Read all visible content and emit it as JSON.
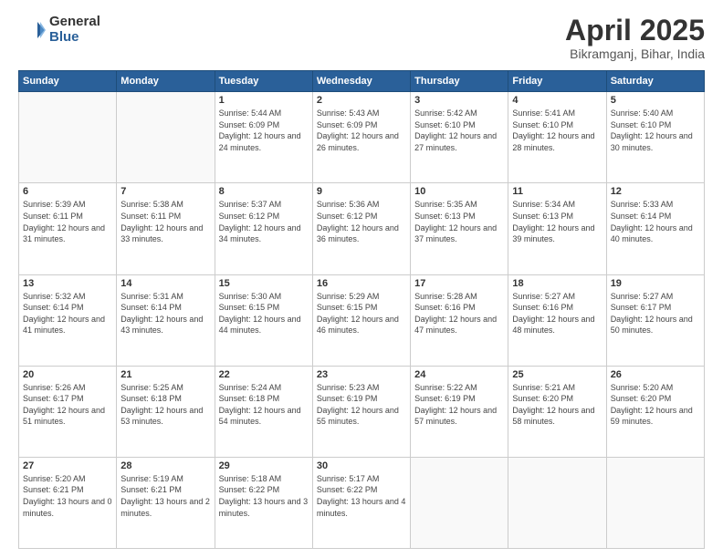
{
  "logo": {
    "general": "General",
    "blue": "Blue"
  },
  "header": {
    "title": "April 2025",
    "subtitle": "Bikramganj, Bihar, India"
  },
  "weekdays": [
    "Sunday",
    "Monday",
    "Tuesday",
    "Wednesday",
    "Thursday",
    "Friday",
    "Saturday"
  ],
  "weeks": [
    [
      null,
      null,
      {
        "day": "1",
        "sunrise": "5:44 AM",
        "sunset": "6:09 PM",
        "daylight": "12 hours and 24 minutes."
      },
      {
        "day": "2",
        "sunrise": "5:43 AM",
        "sunset": "6:09 PM",
        "daylight": "12 hours and 26 minutes."
      },
      {
        "day": "3",
        "sunrise": "5:42 AM",
        "sunset": "6:10 PM",
        "daylight": "12 hours and 27 minutes."
      },
      {
        "day": "4",
        "sunrise": "5:41 AM",
        "sunset": "6:10 PM",
        "daylight": "12 hours and 28 minutes."
      },
      {
        "day": "5",
        "sunrise": "5:40 AM",
        "sunset": "6:10 PM",
        "daylight": "12 hours and 30 minutes."
      }
    ],
    [
      {
        "day": "6",
        "sunrise": "5:39 AM",
        "sunset": "6:11 PM",
        "daylight": "12 hours and 31 minutes."
      },
      {
        "day": "7",
        "sunrise": "5:38 AM",
        "sunset": "6:11 PM",
        "daylight": "12 hours and 33 minutes."
      },
      {
        "day": "8",
        "sunrise": "5:37 AM",
        "sunset": "6:12 PM",
        "daylight": "12 hours and 34 minutes."
      },
      {
        "day": "9",
        "sunrise": "5:36 AM",
        "sunset": "6:12 PM",
        "daylight": "12 hours and 36 minutes."
      },
      {
        "day": "10",
        "sunrise": "5:35 AM",
        "sunset": "6:13 PM",
        "daylight": "12 hours and 37 minutes."
      },
      {
        "day": "11",
        "sunrise": "5:34 AM",
        "sunset": "6:13 PM",
        "daylight": "12 hours and 39 minutes."
      },
      {
        "day": "12",
        "sunrise": "5:33 AM",
        "sunset": "6:14 PM",
        "daylight": "12 hours and 40 minutes."
      }
    ],
    [
      {
        "day": "13",
        "sunrise": "5:32 AM",
        "sunset": "6:14 PM",
        "daylight": "12 hours and 41 minutes."
      },
      {
        "day": "14",
        "sunrise": "5:31 AM",
        "sunset": "6:14 PM",
        "daylight": "12 hours and 43 minutes."
      },
      {
        "day": "15",
        "sunrise": "5:30 AM",
        "sunset": "6:15 PM",
        "daylight": "12 hours and 44 minutes."
      },
      {
        "day": "16",
        "sunrise": "5:29 AM",
        "sunset": "6:15 PM",
        "daylight": "12 hours and 46 minutes."
      },
      {
        "day": "17",
        "sunrise": "5:28 AM",
        "sunset": "6:16 PM",
        "daylight": "12 hours and 47 minutes."
      },
      {
        "day": "18",
        "sunrise": "5:27 AM",
        "sunset": "6:16 PM",
        "daylight": "12 hours and 48 minutes."
      },
      {
        "day": "19",
        "sunrise": "5:27 AM",
        "sunset": "6:17 PM",
        "daylight": "12 hours and 50 minutes."
      }
    ],
    [
      {
        "day": "20",
        "sunrise": "5:26 AM",
        "sunset": "6:17 PM",
        "daylight": "12 hours and 51 minutes."
      },
      {
        "day": "21",
        "sunrise": "5:25 AM",
        "sunset": "6:18 PM",
        "daylight": "12 hours and 53 minutes."
      },
      {
        "day": "22",
        "sunrise": "5:24 AM",
        "sunset": "6:18 PM",
        "daylight": "12 hours and 54 minutes."
      },
      {
        "day": "23",
        "sunrise": "5:23 AM",
        "sunset": "6:19 PM",
        "daylight": "12 hours and 55 minutes."
      },
      {
        "day": "24",
        "sunrise": "5:22 AM",
        "sunset": "6:19 PM",
        "daylight": "12 hours and 57 minutes."
      },
      {
        "day": "25",
        "sunrise": "5:21 AM",
        "sunset": "6:20 PM",
        "daylight": "12 hours and 58 minutes."
      },
      {
        "day": "26",
        "sunrise": "5:20 AM",
        "sunset": "6:20 PM",
        "daylight": "12 hours and 59 minutes."
      }
    ],
    [
      {
        "day": "27",
        "sunrise": "5:20 AM",
        "sunset": "6:21 PM",
        "daylight": "13 hours and 0 minutes."
      },
      {
        "day": "28",
        "sunrise": "5:19 AM",
        "sunset": "6:21 PM",
        "daylight": "13 hours and 2 minutes."
      },
      {
        "day": "29",
        "sunrise": "5:18 AM",
        "sunset": "6:22 PM",
        "daylight": "13 hours and 3 minutes."
      },
      {
        "day": "30",
        "sunrise": "5:17 AM",
        "sunset": "6:22 PM",
        "daylight": "13 hours and 4 minutes."
      },
      null,
      null,
      null
    ]
  ]
}
